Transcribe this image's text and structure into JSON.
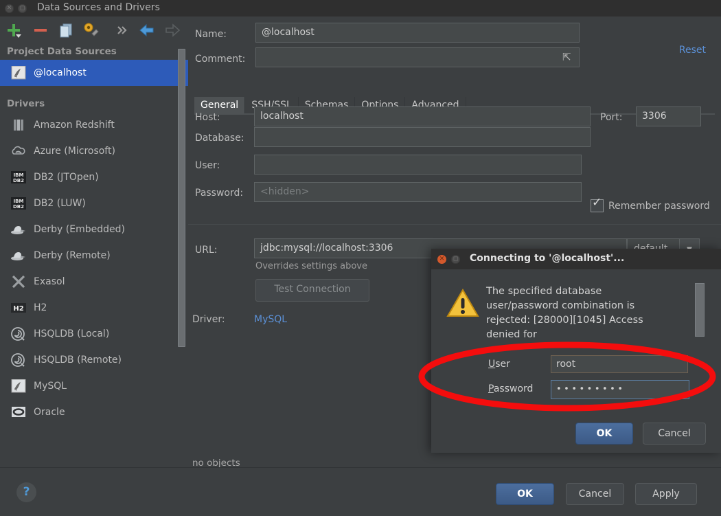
{
  "window": {
    "title": "Data Sources and Drivers",
    "close_icon": "close-icon",
    "minimize_icon": "minimize-icon"
  },
  "toolbar": {
    "buttons": [
      {
        "name": "add-button",
        "icon": "plus-icon",
        "label": "Add"
      },
      {
        "name": "remove-button",
        "icon": "minus-icon",
        "label": "Remove"
      },
      {
        "name": "copy-button",
        "icon": "copy-icon",
        "label": "Copy Settings"
      },
      {
        "name": "driver-properties-button",
        "icon": "wrench-icon",
        "label": "Driver Properties"
      },
      {
        "name": "more-button",
        "icon": "chevron-double-right-icon",
        "label": "More"
      },
      {
        "name": "back-button",
        "icon": "arrow-left-icon",
        "label": "Back"
      },
      {
        "name": "forward-button",
        "icon": "arrow-right-icon",
        "label": "Forward"
      }
    ]
  },
  "sidebar": {
    "project_header": "Project Data Sources",
    "project_items": [
      {
        "label": "@localhost",
        "icon": "mysql-dolphin-icon",
        "selected": true
      }
    ],
    "drivers_header": "Drivers",
    "drivers": [
      {
        "label": "Amazon Redshift",
        "icon": "redshift-icon"
      },
      {
        "label": "Azure (Microsoft)",
        "icon": "azure-cloud-icon"
      },
      {
        "label": "DB2 (JTOpen)",
        "icon": "ibm-db2-icon"
      },
      {
        "label": "DB2 (LUW)",
        "icon": "ibm-db2-icon"
      },
      {
        "label": "Derby (Embedded)",
        "icon": "derby-hat-icon"
      },
      {
        "label": "Derby (Remote)",
        "icon": "derby-hat-icon"
      },
      {
        "label": "Exasol",
        "icon": "exasol-x-icon"
      },
      {
        "label": "H2",
        "icon": "h2-icon"
      },
      {
        "label": "HSQLDB (Local)",
        "icon": "hsqldb-spiral-icon"
      },
      {
        "label": "HSQLDB (Remote)",
        "icon": "hsqldb-spiral-icon"
      },
      {
        "label": "MySQL",
        "icon": "mysql-dolphin-icon"
      },
      {
        "label": "Oracle",
        "icon": "oracle-icon"
      }
    ]
  },
  "detail": {
    "name_label": "Name:",
    "name_value": "@localhost",
    "comment_label": "Comment:",
    "comment_value": "",
    "comment_placeholder": "",
    "expand_icon": "expand-diagonal-icon",
    "reset_label": "Reset",
    "tabs": [
      {
        "label": "General",
        "active": true
      },
      {
        "label": "SSH/SSL",
        "active": false
      },
      {
        "label": "Schemas",
        "active": false
      },
      {
        "label": "Options",
        "active": false
      },
      {
        "label": "Advanced",
        "active": false
      }
    ],
    "host_label": "Host:",
    "host_value": "localhost",
    "port_label": "Port:",
    "port_value": "3306",
    "database_label": "Database:",
    "database_value": "",
    "user_label": "User:",
    "user_value": "",
    "password_label": "Password:",
    "password_placeholder": "<hidden>",
    "remember_password_label": "Remember password",
    "remember_password_checked": true,
    "url_label": "URL:",
    "url_value": "jdbc:mysql://localhost:3306",
    "url_mode_value": "default",
    "url_mode_arrow_icon": "chevron-down-icon",
    "overrides_note": "Overrides settings above",
    "test_connection_label": "Test Connection",
    "driver_label": "Driver:",
    "driver_value": "MySQL",
    "no_objects_label": "no objects"
  },
  "bottom_bar": {
    "help_label": "?",
    "help_icon": "help-icon",
    "ok_label": "OK",
    "cancel_label": "Cancel",
    "apply_label": "Apply"
  },
  "dialog": {
    "title": "Connecting to '@localhost'...",
    "close_icon": "close-icon",
    "minimize_icon": "minimize-icon",
    "warning_icon": "warning-triangle-icon",
    "message": "The specified database user/password combination is rejected: [28000][1045] Access denied for",
    "user_label": "User",
    "user_value": "root",
    "password_label": "Password",
    "password_value": "•••••••••",
    "ok_label": "OK",
    "cancel_label": "Cancel"
  },
  "annotation": {
    "shape": "red-ellipse-highlight",
    "color": "#f40d0d"
  },
  "colors": {
    "background": "#3c3f41",
    "titlebar": "#2f2f2f",
    "selection": "#2d5bb9",
    "link": "#5b90d6",
    "field_bg": "#45494a",
    "annotation_red": "#f40d0d",
    "warning_yellow": "#f5c542"
  }
}
